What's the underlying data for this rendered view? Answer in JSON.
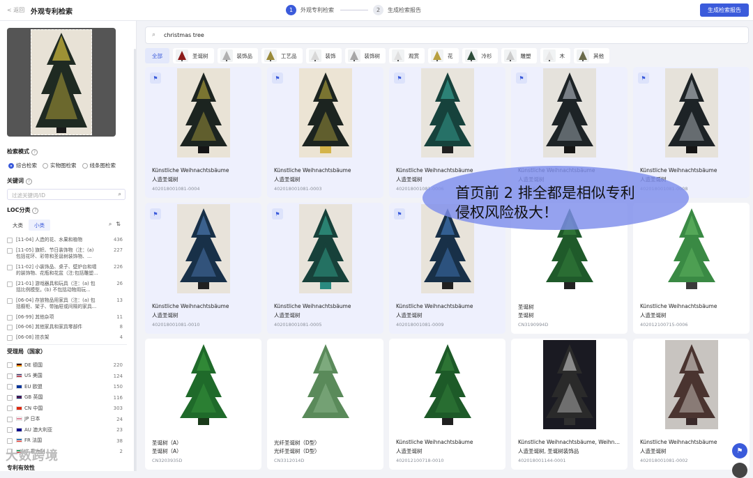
{
  "header": {
    "back_label": "< 返回",
    "page_title": "外观专利检索",
    "steps": [
      {
        "num": "1",
        "label": "外观专利检索"
      },
      {
        "num": "2",
        "label": "生成检索报告"
      }
    ],
    "generate_button": "生成检索报告"
  },
  "sidebar": {
    "mode_title": "检索模式",
    "modes": [
      "综合检索",
      "实物图检索",
      "线条图检索"
    ],
    "keyword_title": "关键词",
    "keyword_placeholder": "过滤关键词/ID",
    "loc_title": "LOC分类",
    "loc_tabs": [
      "大类",
      "小类"
    ],
    "loc_items": [
      {
        "text": "[11-04] 人造的花、水果和植物",
        "count": "436"
      },
      {
        "text": "[11-05] 旗帜、节日装饰物（注：(a) 包括花环、彩带和圣诞树装饰物、...",
        "count": "227"
      },
      {
        "text": "[11-02] 小装饰品、桌子、壁炉台和墙的装饰物、花瓶和花盆（注:包括雕塑...",
        "count": "226"
      },
      {
        "text": "[21-01] 游戏器具和玩具（注：(a) 包括比例模型。(b) 不包括动物用玩...",
        "count": "26"
      },
      {
        "text": "[06-04] 存放物品用家具（注：(a) 包括橱柜、架子、带抽屉或间隔的家具...",
        "count": "13"
      },
      {
        "text": "[06-99] 其他杂项",
        "count": "11"
      },
      {
        "text": "[06-06] 其他家具和家具零部件",
        "count": "8"
      },
      {
        "text": "[06-08] 挂衣架",
        "count": "4"
      }
    ],
    "office_title": "受理局（国家）",
    "offices": [
      {
        "text": "DE 德国",
        "count": "220",
        "c1": "#000000",
        "c2": "#dd0000",
        "c3": "#ffce00"
      },
      {
        "text": "US 美国",
        "count": "124",
        "c1": "#3c3b6e",
        "c2": "#ffffff",
        "c3": "#b22234"
      },
      {
        "text": "EU 欧盟",
        "count": "150",
        "c1": "#003399",
        "c2": "#003399",
        "c3": "#003399"
      },
      {
        "text": "GB 英国",
        "count": "116",
        "c1": "#012169",
        "c2": "#c8102e",
        "c3": "#012169"
      },
      {
        "text": "CN 中国",
        "count": "303",
        "c1": "#de2910",
        "c2": "#de2910",
        "c3": "#de2910"
      },
      {
        "text": "JP 日本",
        "count": "24",
        "c1": "#ffffff",
        "c2": "#bc002d",
        "c3": "#ffffff"
      },
      {
        "text": "AU 澳大利亚",
        "count": "23",
        "c1": "#00008b",
        "c2": "#00008b",
        "c3": "#00008b"
      },
      {
        "text": "FR 法国",
        "count": "38",
        "c1": "#0055a4",
        "c2": "#ffffff",
        "c3": "#ef4135"
      },
      {
        "text": "IT 意大利",
        "count": "2",
        "c1": "#009246",
        "c2": "#ffffff",
        "c3": "#ce2b37"
      }
    ],
    "validity_title": "专利有效性",
    "watermark": "大数跨境"
  },
  "search": {
    "query": "christmas tree"
  },
  "chips": [
    {
      "label": "全部",
      "tree": "",
      "active": true
    },
    {
      "label": "圣诞树",
      "tree": "#8b1a1a",
      "active": false
    },
    {
      "label": "装饰品",
      "tree": "#b0b0b0",
      "active": false
    },
    {
      "label": "工艺品",
      "tree": "#9a8a3a",
      "active": false
    },
    {
      "label": "装饰",
      "tree": "#d8d8d8",
      "active": false
    },
    {
      "label": "装饰树",
      "tree": "#a6a6a6",
      "active": false
    },
    {
      "label": "观赏",
      "tree": "#e0e0e0",
      "active": false
    },
    {
      "label": "花",
      "tree": "#b8a040",
      "active": false
    },
    {
      "label": "冷杉",
      "tree": "#2d4d3a",
      "active": false
    },
    {
      "label": "雕塑",
      "tree": "#cccccc",
      "active": false
    },
    {
      "label": "木",
      "tree": "#e6e6e6",
      "active": false
    },
    {
      "label": "其他",
      "tree": "#6a6a4a",
      "active": false
    }
  ],
  "results": [
    {
      "title": "Künstliche Weihnachtsbäume",
      "sub": "人造圣诞树",
      "id": "402018001081-0004",
      "flag": true,
      "highlight": true,
      "tree_color": "#1c2420",
      "accent": "#c9b640",
      "bg": "#e9e3d6",
      "pot": "#151515"
    },
    {
      "title": "Künstliche Weihnachtsbäume",
      "sub": "人造圣诞树",
      "id": "402018001081-0003",
      "flag": true,
      "highlight": true,
      "tree_color": "#1c2420",
      "accent": "#c9b640",
      "bg": "#ece4d4",
      "pot": "#d4b44a"
    },
    {
      "title": "Künstliche Weihnachtsbäume",
      "sub": "人造圣诞树",
      "id": "402018001081-0006",
      "flag": true,
      "highlight": true,
      "tree_color": "#16423c",
      "accent": "#3fb8a8",
      "bg": "#e8e4dc",
      "pot": "#202020"
    },
    {
      "title": "Künstliche Weihnachtsbäume",
      "sub": "人造圣诞树",
      "id": "402018001081-0007",
      "flag": true,
      "highlight": true,
      "tree_color": "#1d2326",
      "accent": "#c4ccd6",
      "bg": "#e5e2dc",
      "pot": "#151515"
    },
    {
      "title": "Künstliche Weihnachtsbäume",
      "sub": "人造圣诞树",
      "id": "402018001081-0008",
      "flag": true,
      "highlight": true,
      "tree_color": "#1d2326",
      "accent": "#d4dae0",
      "bg": "#e6e2da",
      "pot": "#151515"
    },
    {
      "title": "Künstliche Weihnachtsbäume",
      "sub": "人造圣诞树",
      "id": "402018001081-0010",
      "flag": true,
      "highlight": true,
      "tree_color": "#183048",
      "accent": "#5a8ac8",
      "bg": "#e8e3da",
      "pot": "#202020"
    },
    {
      "title": "Künstliche Weihnachtsbäume",
      "sub": "人造圣诞树",
      "id": "402018001081-0005",
      "flag": true,
      "highlight": true,
      "tree_color": "#17413a",
      "accent": "#3ab8a0",
      "bg": "#e8e3da",
      "pot": "#2a8a80"
    },
    {
      "title": "Künstliche Weihnachtsbäume",
      "sub": "人造圣诞树",
      "id": "402018001081-0009",
      "flag": true,
      "highlight": true,
      "tree_color": "#183048",
      "accent": "#4a86d0",
      "bg": "#e8e3da",
      "pot": "#202020"
    },
    {
      "title": "圣诞树",
      "sub": "圣诞树",
      "id": "CN3190994D",
      "flag": false,
      "highlight": false,
      "tree_color": "#1f5a2a",
      "accent": "#3c8a40",
      "bg": "#ffffff",
      "pot": "#222222"
    },
    {
      "title": "Künstliche Weihnachtsbäume",
      "sub": "人造圣诞树",
      "id": "402012100715-0006",
      "flag": false,
      "highlight": false,
      "tree_color": "#3a8a44",
      "accent": "#6cbf6a",
      "bg": "#ffffff",
      "pot": "#3a3a3a"
    },
    {
      "title": "圣诞树（A）",
      "sub": "圣诞树（A）",
      "id": "CN3203935D",
      "flag": false,
      "highlight": false,
      "tree_color": "#1f6a2a",
      "accent": "#3ea040",
      "bg": "#ffffff",
      "pot": "#1a3a1a"
    },
    {
      "title": "光纤圣诞树（D型）",
      "sub": "光纤圣诞树（D型）",
      "id": "CN3312014D",
      "flag": false,
      "highlight": false,
      "tree_color": "#5a8a5a",
      "accent": "#9ac49a",
      "bg": "#ffffff",
      "pot": "#ffffff"
    },
    {
      "title": "Künstliche Weihnachtsbäume",
      "sub": "人造圣诞树",
      "id": "402012100718-0010",
      "flag": false,
      "highlight": false,
      "tree_color": "#1d5a28",
      "accent": "#3a8a3e",
      "bg": "#ffffff",
      "pot": "#202020"
    },
    {
      "title": "Künstliche Weihnachtsbäume, Weihnac...",
      "sub": "人造圣诞树, 圣诞树装饰品",
      "id": "402018001144-0001",
      "flag": false,
      "highlight": false,
      "tree_color": "#2a2a2a",
      "accent": "#d8d8d8",
      "bg": "#1a1a22",
      "pot": "#303030"
    },
    {
      "title": "Künstliche Weihnachtsbäume",
      "sub": "人造圣诞树",
      "id": "402018001081-0002",
      "flag": false,
      "highlight": false,
      "tree_color": "#4a3430",
      "accent": "#e8e6e2",
      "bg": "#c8c4c0",
      "pot": "#3a2a2a"
    }
  ],
  "annotation": {
    "line1": "首页前 2 排全都是相似专利",
    "line2": "侵权风险极大！"
  }
}
